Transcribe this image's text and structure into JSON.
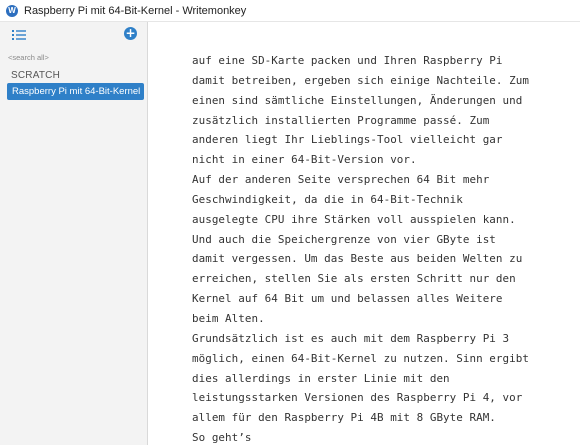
{
  "window": {
    "title": "Raspberry Pi mit 64-Bit-Kernel - Writemonkey"
  },
  "sidebar": {
    "search_placeholder": "<search all>",
    "section_header": "SCRATCH",
    "items": [
      {
        "label": "Raspberry Pi mit 64-Bit-Kernel",
        "selected": true
      }
    ]
  },
  "editor": {
    "lines": [
      "auf eine SD-Karte packen und Ihren Raspberry Pi",
      "damit betreiben, ergeben sich einige Nachteile. Zum",
      "einen sind sämtliche Einstellungen, Änderungen und",
      "zusätzlich installierten Programme passé. Zum",
      "anderen liegt Ihr Lieblings-Tool vielleicht gar",
      "nicht in einer 64-Bit-Version vor.",
      "Auf der anderen Seite versprechen 64 Bit mehr",
      "Geschwindigkeit, da die in 64-Bit-Technik",
      "ausgelegte CPU ihre Stärken voll ausspielen kann.",
      "Und auch die Speichergrenze von vier GByte ist",
      "damit vergessen. Um das Beste aus beiden Welten zu",
      "erreichen, stellen Sie als ersten Schritt nur den",
      "Kernel auf 64 Bit um und belassen alles Weitere",
      "beim Alten.",
      "Grundsätzlich ist es auch mit dem Raspberry Pi 3",
      "möglich, einen 64-Bit-Kernel zu nutzen. Sinn ergibt",
      "dies allerdings in erster Linie mit den",
      "leistungsstarken Versionen des Raspberry Pi 4, vor",
      "allem für den Raspberry Pi 4B mit 8 GByte RAM.",
      "So geht’s"
    ]
  },
  "colors": {
    "accent": "#2f80c8",
    "sidebar_bg": "#f3f3f3",
    "text": "#333333"
  },
  "icons": {
    "app": "writemonkey-app-icon",
    "list": "list-icon",
    "add": "add-icon"
  }
}
